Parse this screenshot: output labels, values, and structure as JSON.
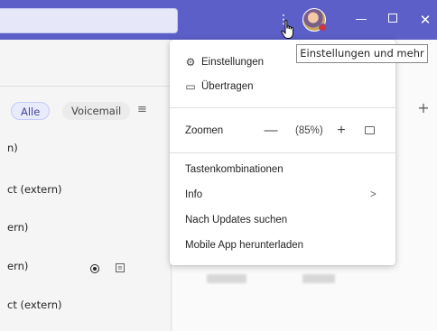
{
  "tooltip": {
    "text": "Einstellungen und mehr"
  },
  "filters": {
    "all": "Alle",
    "voicemail": "Voicemail"
  },
  "rows": [
    "n)",
    "ct (extern)",
    "ern)",
    "ern)",
    "ct (extern)"
  ],
  "menu": {
    "settings": "Einstellungen",
    "cast": "Übertragen",
    "zoom_label": "Zoomen",
    "zoom_value": "(85%)",
    "shortcuts": "Tastenkombinationen",
    "info": "Info",
    "updates": "Nach Updates suchen",
    "mobile_app": "Mobile App herunterladen"
  },
  "icons": {
    "more": "more-dots-icon",
    "settings": "gear-icon",
    "cast": "cast-icon",
    "zoom_out": "minus-icon",
    "zoom_in": "plus-icon",
    "fullscreen": "fullscreen-icon",
    "info_chevron": "chevron-right-icon",
    "filter": "filter-icon",
    "add": "plus-icon"
  },
  "colors": {
    "titlebar": "#5b5fc7",
    "accent": "#444791",
    "status": "#d13438"
  }
}
